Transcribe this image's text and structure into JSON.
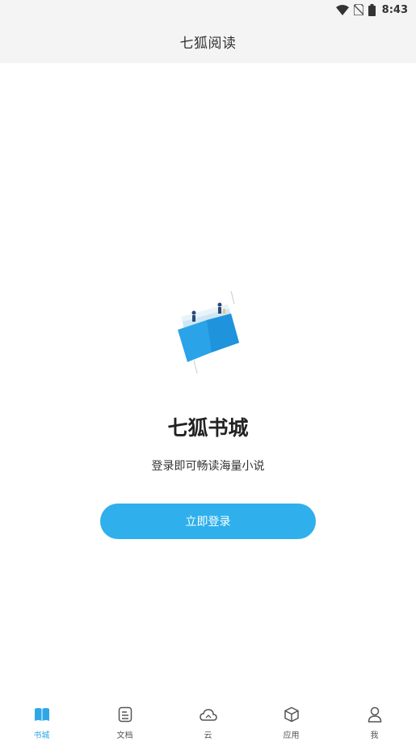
{
  "status_bar": {
    "time": "8:43",
    "icons": [
      "wifi-icon",
      "no-sim-icon",
      "battery-icon"
    ]
  },
  "app_bar": {
    "title": "七狐阅读"
  },
  "promo": {
    "illustration": "open-book-illustration-icon",
    "title": "七狐书城",
    "subtitle": "登录即可畅读海量小说",
    "login_label": "立即登录"
  },
  "tabs": [
    {
      "label": "书城",
      "icon": "book-icon",
      "active": true
    },
    {
      "label": "文档",
      "icon": "document-icon",
      "active": false
    },
    {
      "label": "云",
      "icon": "cloud-icon",
      "active": false
    },
    {
      "label": "应用",
      "icon": "cube-icon",
      "active": false
    },
    {
      "label": "我",
      "icon": "person-icon",
      "active": false
    }
  ],
  "colors": {
    "accent": "#2fb0ec",
    "active_tab": "#2fa7e6",
    "bar_background": "#f4f4f4"
  }
}
